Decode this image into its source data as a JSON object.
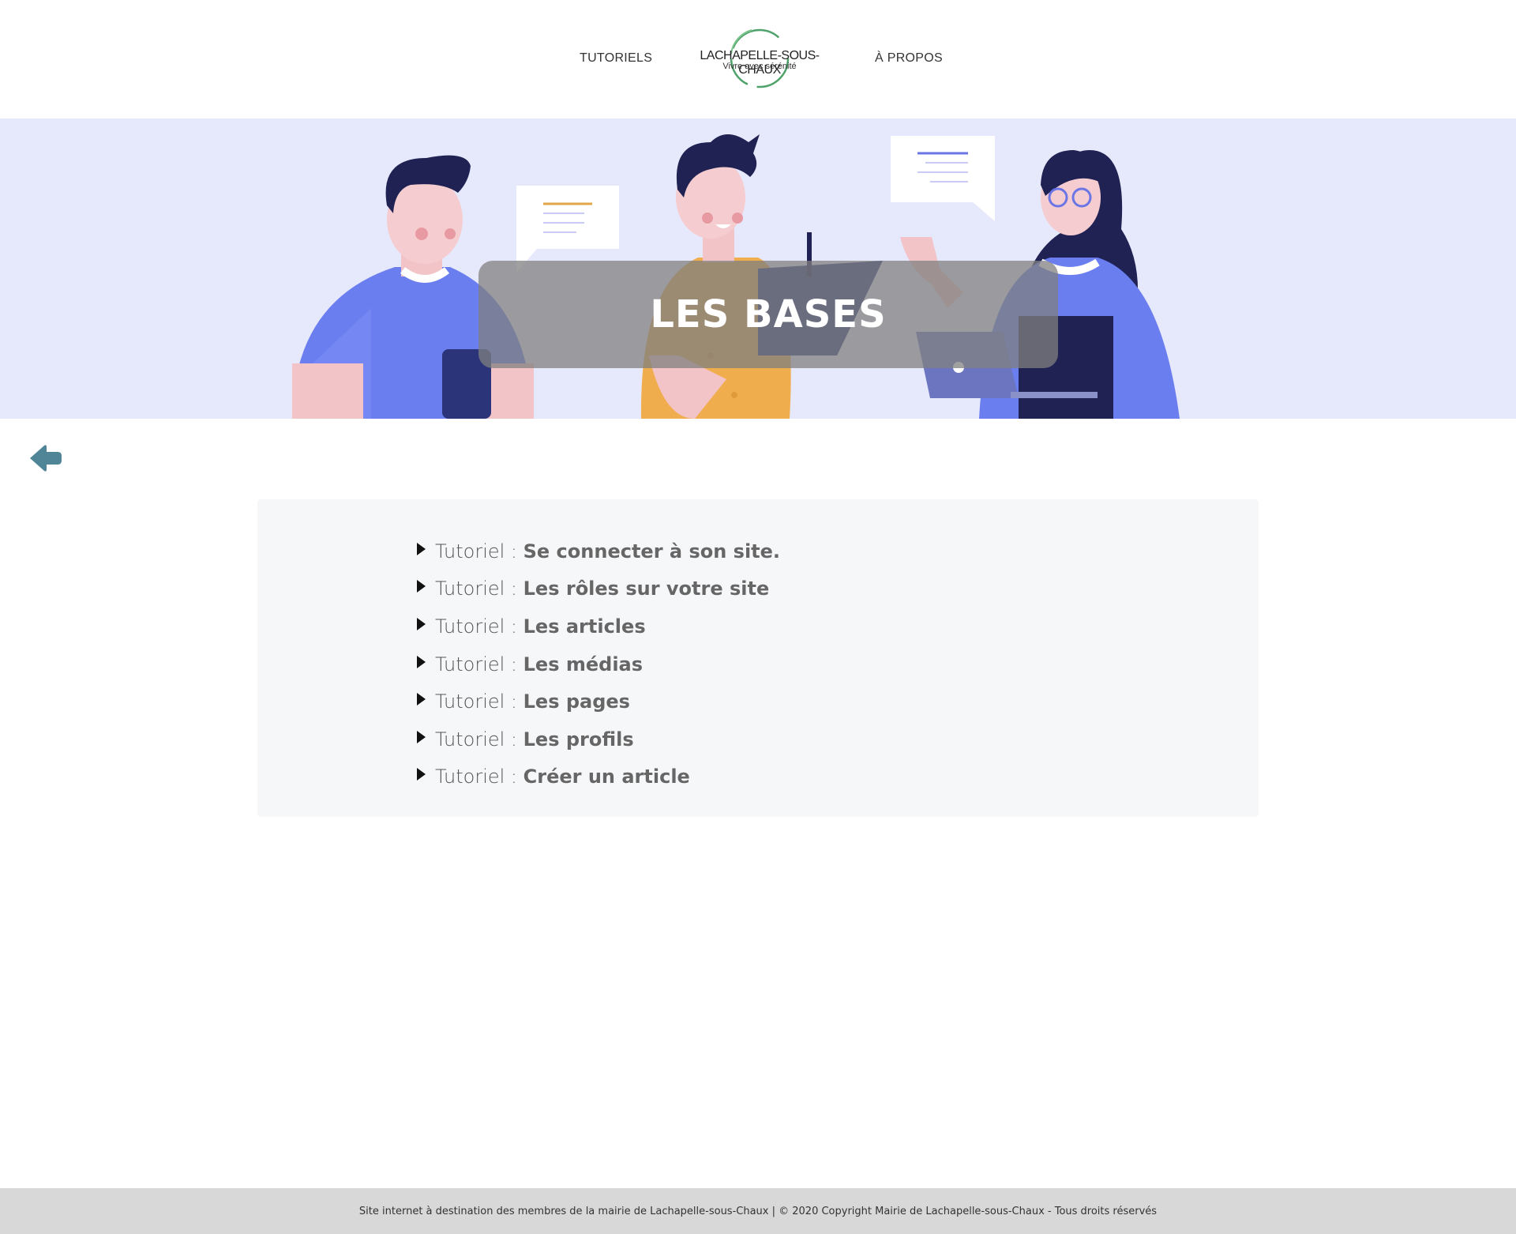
{
  "nav": {
    "tutoriels": "TUTORIELS",
    "apropos": "À PROPOS"
  },
  "logo": {
    "name": "LACHAPELLE-SOUS-CHAUX",
    "tagline": "Vivre avec sérénité"
  },
  "hero": {
    "title": "LES BASES"
  },
  "tutorials": [
    {
      "prefix": "Tutoriel : ",
      "title": "Se connecter à son site."
    },
    {
      "prefix": "Tutoriel : ",
      "title": "Les rôles sur votre site"
    },
    {
      "prefix": "Tutoriel : ",
      "title": "Les articles"
    },
    {
      "prefix": "Tutoriel : ",
      "title": "Les médias"
    },
    {
      "prefix": "Tutoriel : ",
      "title": "Les pages"
    },
    {
      "prefix": "Tutoriel : ",
      "title": "Les profils"
    },
    {
      "prefix": "Tutoriel : ",
      "title": "Créer un article"
    }
  ],
  "footer": {
    "text": "Site internet à destination des membres de la mairie de Lachapelle-sous-Chaux | © 2020 Copyright Mairie de Lachapelle-sous-Chaux - Tous droits réservés"
  },
  "icons": {
    "back": "back-arrow-icon",
    "item": "caret-right-icon"
  },
  "colors": {
    "hero_bg": "#e6e8fb",
    "back_arrow": "#4f8596",
    "panel_bg": "#f6f7f9",
    "footer_bg": "#d8d8d8"
  }
}
